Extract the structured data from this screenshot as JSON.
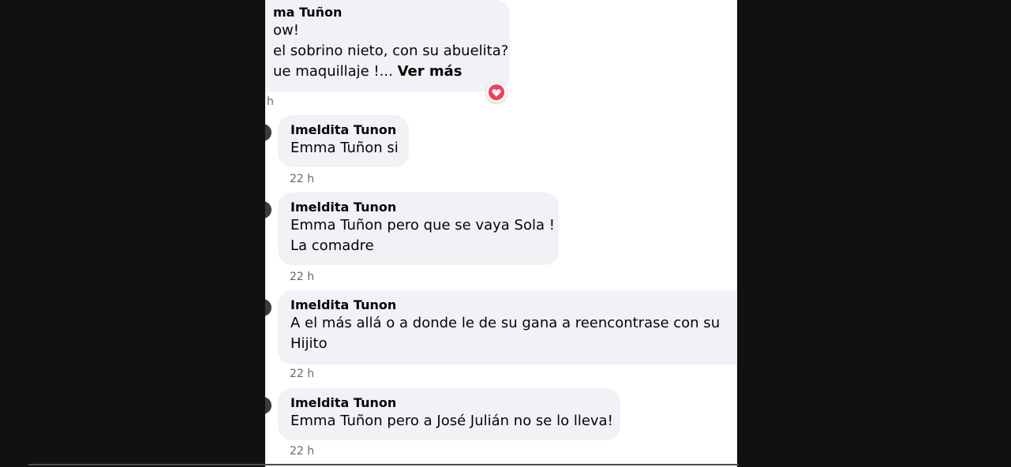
{
  "colors": {
    "background": "#111111",
    "panel": "#ffffff",
    "bubble": "#f0f2f5",
    "text": "#050505",
    "time_text": "#65676b",
    "reaction_heart": "#f33e58"
  },
  "comments": [
    {
      "author": "ma Tuñon",
      "lines": [
        "ow!",
        "el sobrino nieto, con su abuelita?",
        "ue maquillaje !..."
      ],
      "see_more": "Ver más",
      "time": "h",
      "reaction_icon": "heart-reaction-icon"
    },
    {
      "author": "Imeldita Tunon",
      "lines": [
        "Emma Tuñon si"
      ],
      "time": "22 h"
    },
    {
      "author": "Imeldita Tunon",
      "lines": [
        "Emma Tuñon pero que se vaya Sola !",
        "La comadre"
      ],
      "time": "22 h"
    },
    {
      "author": "Imeldita Tunon",
      "lines": [
        "A el más allá o a donde le de su gana a reencontrase con su",
        "Hijito"
      ],
      "time": "22 h"
    },
    {
      "author": "Imeldita Tunon",
      "lines": [
        "Emma Tuñon pero a José Julián no se lo lleva!"
      ],
      "time": "22 h"
    }
  ]
}
